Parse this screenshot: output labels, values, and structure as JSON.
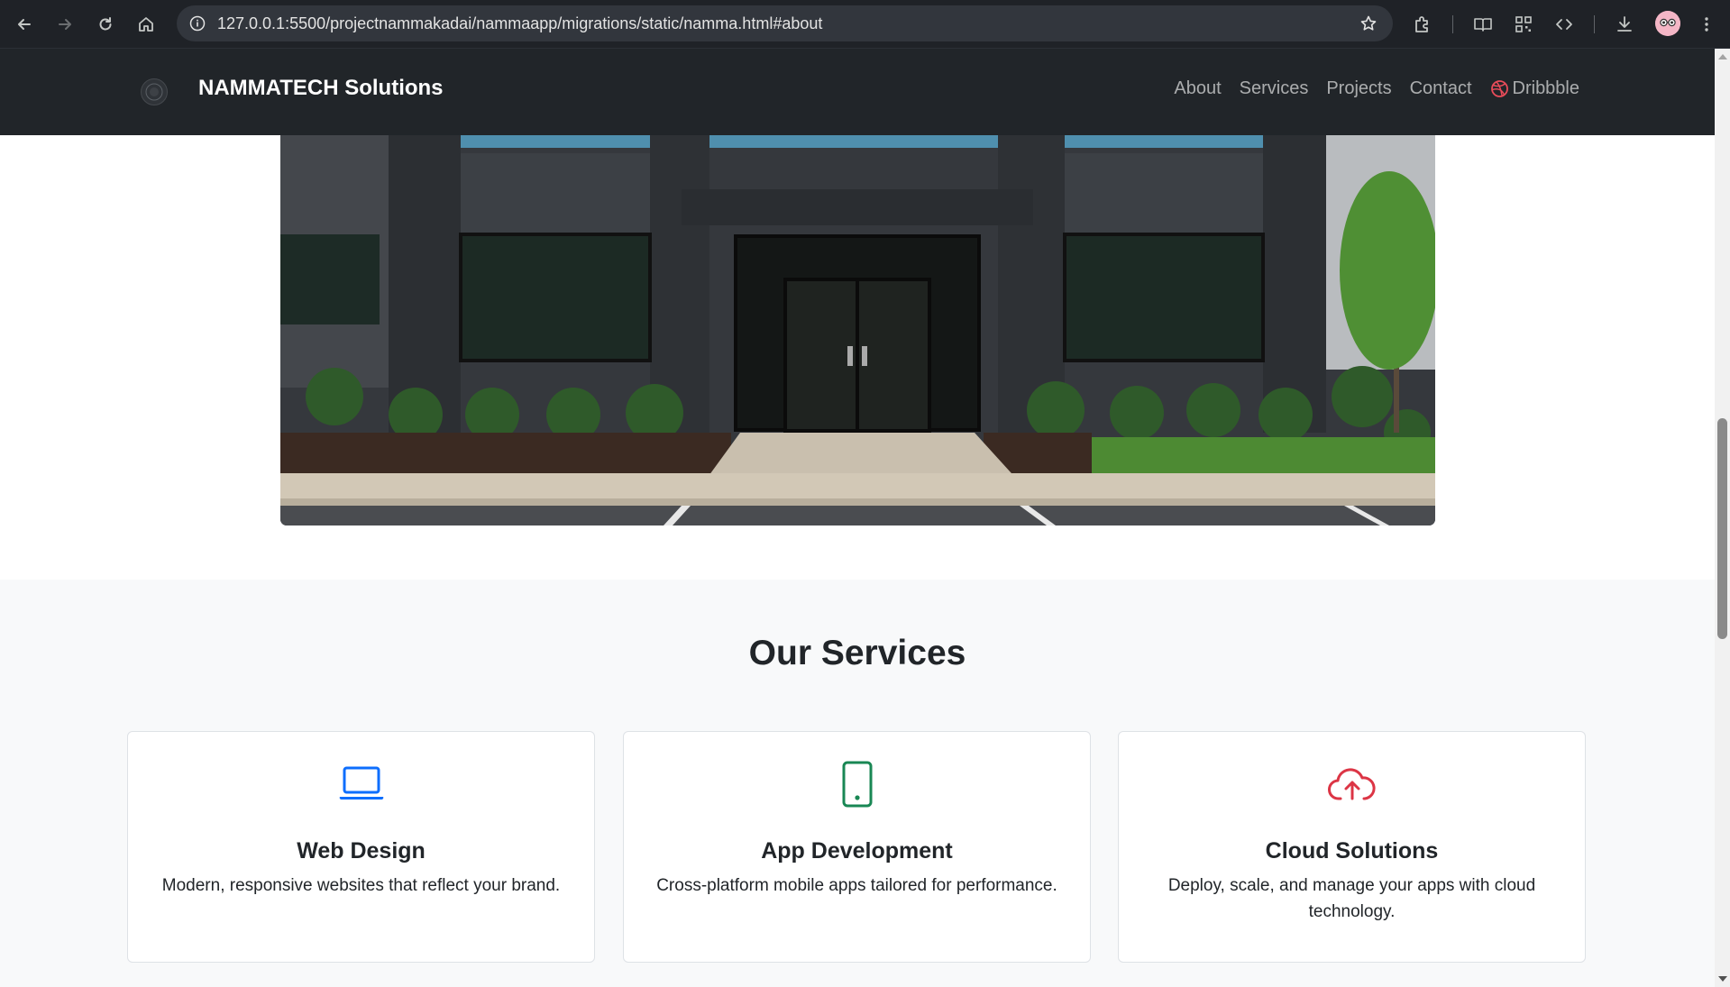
{
  "browser": {
    "url": "127.0.0.1:5500/projectnammakadai/nammaapp/migrations/static/namma.html#about",
    "icons": [
      "back-icon",
      "forward-icon",
      "reload-icon",
      "home-icon",
      "site-info-icon",
      "bookmark-star-icon",
      "extensions-icon",
      "reading-mode-icon",
      "qr-code-icon",
      "devtools-icon",
      "download-icon",
      "profile-avatar",
      "more-menu-icon"
    ]
  },
  "navbar": {
    "brand": "NAMMATECH Solutions",
    "links": [
      {
        "label": "About"
      },
      {
        "label": "Services"
      },
      {
        "label": "Projects"
      },
      {
        "label": "Contact"
      },
      {
        "label": "Dribbble",
        "icon": "dribbble-icon"
      }
    ],
    "background": "#212529"
  },
  "services": {
    "title": "Our Services",
    "cards": [
      {
        "icon": "laptop-icon",
        "icon_color": "#0d6efd",
        "title": "Web Design",
        "text": "Modern, responsive websites that reflect your brand."
      },
      {
        "icon": "phone-icon",
        "icon_color": "#198754",
        "title": "App Development",
        "text": "Cross-platform mobile apps tailored for performance."
      },
      {
        "icon": "cloud-upload-icon",
        "icon_color": "#dc3545",
        "title": "Cloud Solutions",
        "text": "Deploy, scale, and manage your apps with cloud technology."
      }
    ]
  },
  "colors": {
    "accent_blue": "#0d6efd",
    "accent_green": "#198754",
    "accent_red": "#dc3545",
    "section_bg": "#f8f9fa"
  }
}
